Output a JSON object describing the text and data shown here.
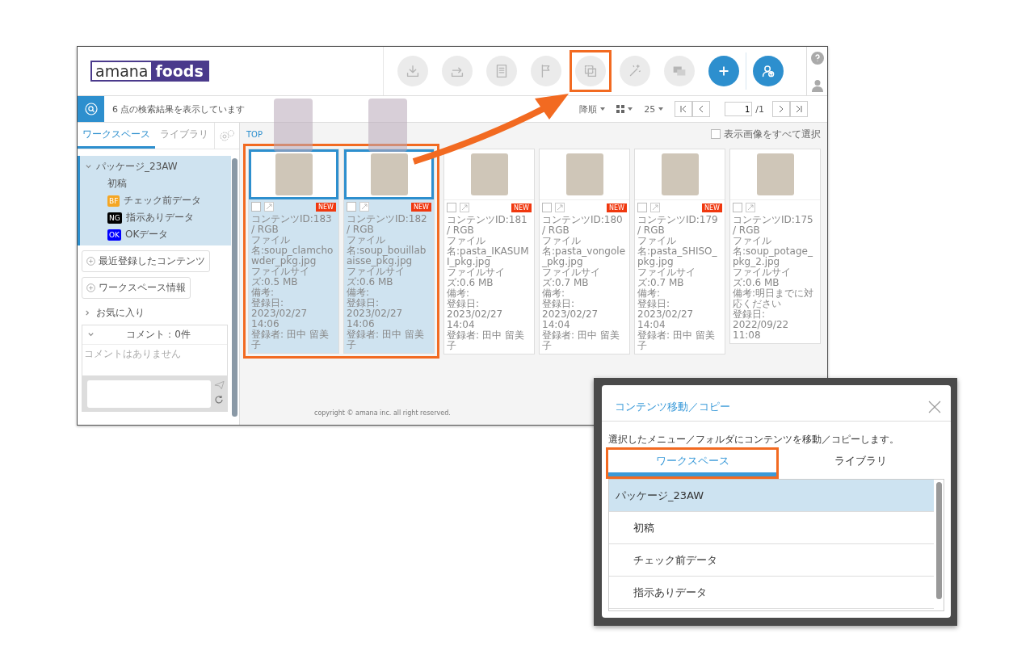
{
  "app": {
    "logo": {
      "left": "amana",
      "right": "foods"
    },
    "toolbar": [
      {
        "kind": "download",
        "highlighted": false
      },
      {
        "kind": "move",
        "highlighted": false
      },
      {
        "kind": "document",
        "highlighted": false
      },
      {
        "kind": "flag",
        "highlighted": false
      },
      {
        "kind": "copy",
        "highlighted": true
      },
      {
        "kind": "magic",
        "highlighted": false
      },
      {
        "kind": "screens",
        "highlighted": false
      },
      {
        "kind": "add",
        "highlighted": false
      },
      {
        "kind": "user-upload",
        "highlighted": false
      }
    ],
    "search_bar": {
      "result_text": "6 点の検索結果を表示しています",
      "sort": "降順",
      "per_page": "25",
      "page": "1",
      "page_total": "/1"
    },
    "sidebar": {
      "tabs": [
        {
          "label": "ワークスペース",
          "selected": true
        },
        {
          "label": "ライブラリ",
          "selected": false
        }
      ],
      "tree": [
        {
          "label": "パッケージ_23AW",
          "expanded": true,
          "selected": true,
          "children": [
            {
              "label": "初稿",
              "selected": false
            },
            {
              "label": "チェック前データ",
              "badge": "BF",
              "color": "#f5a623",
              "selected": false
            },
            {
              "label": "指示ありデータ",
              "badge": "NG",
              "color": "#000000",
              "selected": false
            },
            {
              "label": "OKデータ",
              "badge": "OK",
              "color": "#0000ff",
              "selected": false
            }
          ]
        }
      ],
      "buttons": [
        "最近登録したコンテンツ",
        "ワークスペース情報"
      ],
      "favorites": {
        "label": "お気に入り",
        "expanded": false
      },
      "comments": {
        "header": "コメント：0件",
        "empty_text": "コメントはありません"
      }
    },
    "breadcrumb": [
      "TOP"
    ],
    "select_all": {
      "label": "表示画像をすべて選択",
      "checked": false
    },
    "cards": [
      {
        "id_line": "コンテンツID:183 / RGB",
        "file": "ファイル名:soup_clamchowder_pkg.jpg",
        "size": "ファイルサイズ:0.5 MB",
        "note": "備考:",
        "date": "登録日: 2023/02/27 14:06",
        "registrant": "登録者: 田中 留美子",
        "badge": "NEW",
        "selected": true,
        "checked": false,
        "highlighted": true
      },
      {
        "id_line": "コンテンツID:182 / RGB",
        "file": "ファイル名:soup_bouillabaisse_pkg.jpg",
        "size": "ファイルサイズ:0.6 MB",
        "note": "備考:",
        "date": "登録日: 2023/02/27 14:06",
        "registrant": "登録者: 田中 留美子",
        "badge": "NEW",
        "selected": true,
        "checked": false,
        "highlighted": true
      },
      {
        "id_line": "コンテンツID:181 / RGB",
        "file": "ファイル名:pasta_IKASUMI_pkg.jpg",
        "size": "ファイルサイズ:0.6 MB",
        "note": "備考:",
        "date": "登録日: 2023/02/27 14:04",
        "registrant": "登録者: 田中 留美子",
        "badge": "NEW",
        "selected": false,
        "checked": false,
        "highlighted": false
      },
      {
        "id_line": "コンテンツID:180 / RGB",
        "file": "ファイル名:pasta_vongole_pkg.jpg",
        "size": "ファイルサイズ:0.7 MB",
        "note": "備考:",
        "date": "登録日: 2023/02/27 14:04",
        "registrant": "登録者: 田中 留美子",
        "badge": "NEW",
        "selected": false,
        "checked": false,
        "highlighted": false
      },
      {
        "id_line": "コンテンツID:179 / RGB",
        "file": "ファイル名:pasta_SHISO_pkg.jpg",
        "size": "ファイルサイズ:0.7 MB",
        "note": "備考:",
        "date": "登録日: 2023/02/27 14:04",
        "registrant": "登録者: 田中 留美子",
        "badge": "NEW",
        "selected": false,
        "checked": false,
        "highlighted": false
      },
      {
        "id_line": "コンテンツID:175 / RGB",
        "file": "ファイル名:soup_potage_pkg_2.jpg",
        "size": "ファイルサイズ:0.6 MB",
        "note": "備考:明日までに対応ください",
        "date": "登録日: 2022/09/22 11:08",
        "selected": false,
        "checked": false,
        "highlighted": false
      }
    ],
    "footer": "copyright © amana inc. all right reserved."
  },
  "dialog": {
    "title": "コンテンツ移動／コピー",
    "description": "選択したメニュー／フォルダにコンテンツを移動／コピーします。",
    "tabs": [
      {
        "label": "ワークスペース",
        "selected": true,
        "highlighted": true
      },
      {
        "label": "ライブラリ",
        "selected": false,
        "highlighted": false
      }
    ],
    "folders": [
      {
        "label": "パッケージ_23AW",
        "selected": true,
        "children": [
          {
            "label": "初稿",
            "selected": false
          },
          {
            "label": "チェック前データ",
            "selected": false
          },
          {
            "label": "指示ありデータ",
            "selected": false
          }
        ]
      }
    ]
  }
}
